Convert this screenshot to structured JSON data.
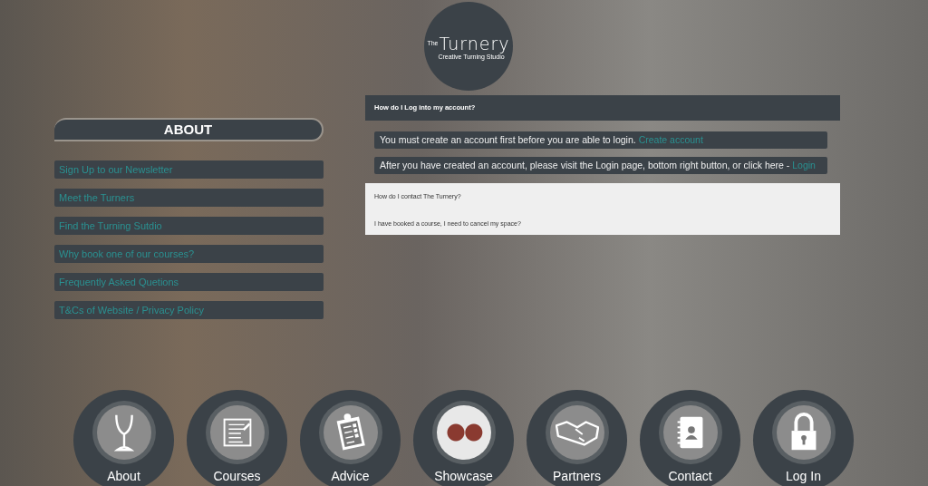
{
  "logo": {
    "prefix": "The",
    "title": "Turnery",
    "tagline": "Creative Turning Studio"
  },
  "sidebar": {
    "heading": "ABOUT",
    "items": [
      {
        "label": "Sign Up to our Newsletter"
      },
      {
        "label": "Meet the Turners"
      },
      {
        "label": "Find the Turning Sutdio"
      },
      {
        "label": "Why book one of our courses?"
      },
      {
        "label": "Frequently Asked Quetions"
      },
      {
        "label": "T&Cs of Website / Privacy Policy"
      }
    ]
  },
  "faq": [
    {
      "question": "How do I Log into my account?",
      "expanded": true,
      "answers": [
        {
          "text": "You must create an account first before you are able to login. ",
          "link": "Create account"
        },
        {
          "text": "After you have created an account, please visit the Login page, bottom right button, or click here - ",
          "link": "Login"
        }
      ]
    },
    {
      "question": "How do I contact The Turnery?",
      "expanded": false
    },
    {
      "question": "I have booked a course, I need to cancel my space?",
      "expanded": false
    }
  ],
  "nav": [
    {
      "label": "About",
      "kind": "goblet"
    },
    {
      "label": "Courses",
      "kind": "document"
    },
    {
      "label": "Advice",
      "kind": "clipboard"
    },
    {
      "label": "Showcase",
      "kind": "photo"
    },
    {
      "label": "Partners",
      "kind": "handshake"
    },
    {
      "label": "Contact",
      "kind": "addressbook"
    },
    {
      "label": "Log In",
      "kind": "lock"
    }
  ]
}
